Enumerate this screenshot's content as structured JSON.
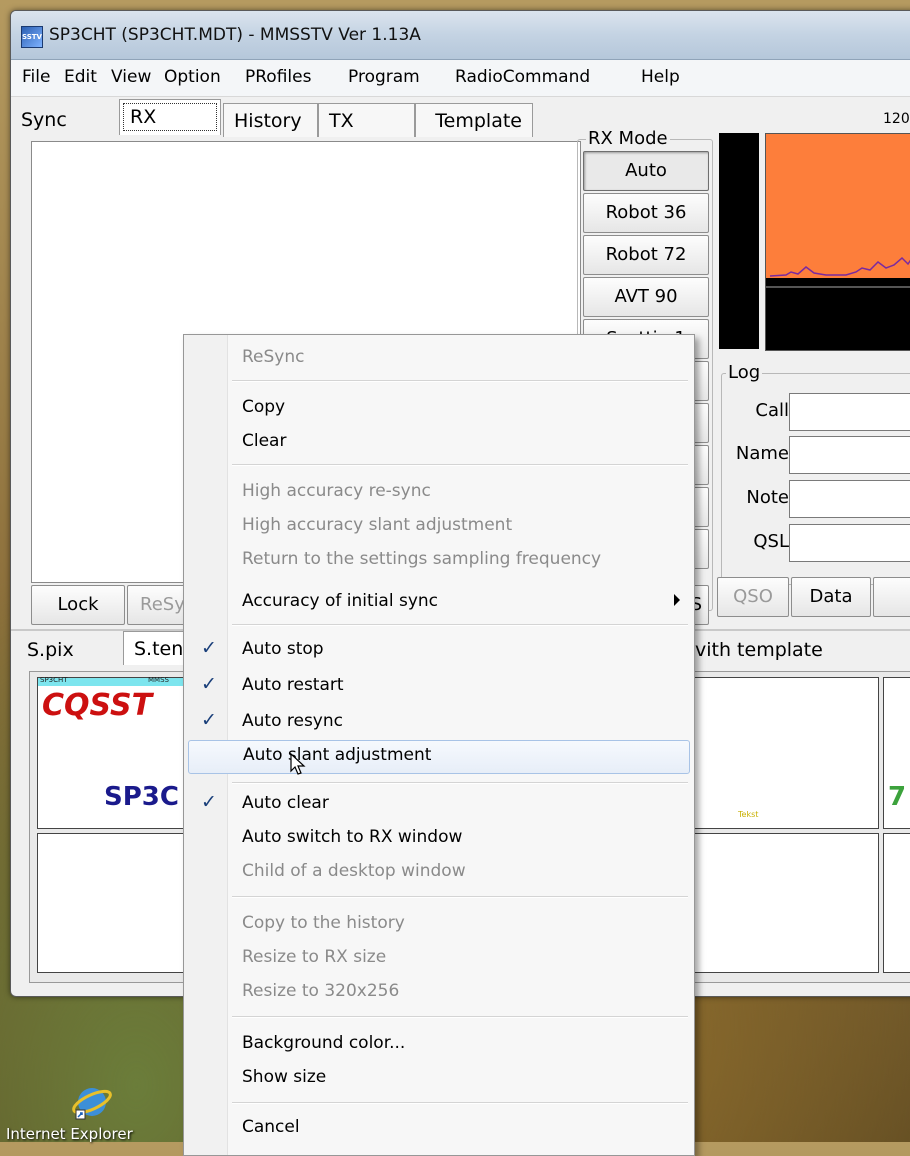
{
  "window": {
    "title": "SP3CHT (SP3CHT.MDT) - MMSSTV Ver 1.13A",
    "app_icon_text": "SSTV"
  },
  "menu": [
    "File",
    "Edit",
    "View",
    "Option",
    "PRofiles",
    "Program",
    "RadioCommand",
    "Help"
  ],
  "tabs": [
    "Sync",
    "RX",
    "History",
    "TX",
    "Template"
  ],
  "freq_label": "120",
  "rx_mode": {
    "label": "RX Mode",
    "buttons": [
      "Auto",
      "Robot 36",
      "Robot 72",
      "AVT 90",
      "Scottie 1"
    ]
  },
  "log": {
    "label": "Log",
    "fields": {
      "call": "Call",
      "name": "Name",
      "note": "Note",
      "qsl": "QSL"
    },
    "buttons": {
      "qso": "QSO",
      "data": "Data"
    }
  },
  "bottom_buttons": {
    "lock": "Lock",
    "resync": "ReSy",
    "s_partial": "S"
  },
  "lower_tabs": [
    "S.pix",
    "S.ten"
  ],
  "lower_tab_fragment": "vith template",
  "thumbnails": {
    "t1_title": "CQSST",
    "t1_call": "SP3C",
    "t1_header_left": "SP3CHT",
    "t1_header_right": "MMSS",
    "t3_text": "7",
    "t3_small": "Tekst"
  },
  "context_menu": {
    "items": [
      {
        "label": "ReSync",
        "disabled": true
      },
      {
        "label": "Copy"
      },
      {
        "label": "Clear"
      },
      {
        "label": "High accuracy re-sync",
        "disabled": true
      },
      {
        "label": "High accuracy slant adjustment",
        "disabled": true
      },
      {
        "label": "Return to the settings sampling frequency",
        "disabled": true
      },
      {
        "label": "Accuracy of initial sync",
        "submenu": true
      },
      {
        "label": "Auto stop",
        "checked": true
      },
      {
        "label": "Auto restart",
        "checked": true
      },
      {
        "label": "Auto resync",
        "checked": true
      },
      {
        "label": "Auto slant adjustment",
        "highlighted": true
      },
      {
        "label": "Auto clear",
        "checked": true
      },
      {
        "label": "Auto switch to RX window"
      },
      {
        "label": "Child of a desktop window",
        "disabled": true
      },
      {
        "label": "Copy to the history",
        "disabled": true
      },
      {
        "label": "Resize to RX size",
        "disabled": true
      },
      {
        "label": "Resize to 320x256",
        "disabled": true
      },
      {
        "label": "Background color..."
      },
      {
        "label": "Show size"
      },
      {
        "label": "Cancel"
      }
    ],
    "check_glyph": "✓"
  },
  "desktop": {
    "icon_label": "Internet Explorer"
  },
  "colors": {
    "spectrum_orange": "#fd7e3b",
    "thumb_red": "#cc1010",
    "thumb_blue": "#1a1a8c"
  }
}
